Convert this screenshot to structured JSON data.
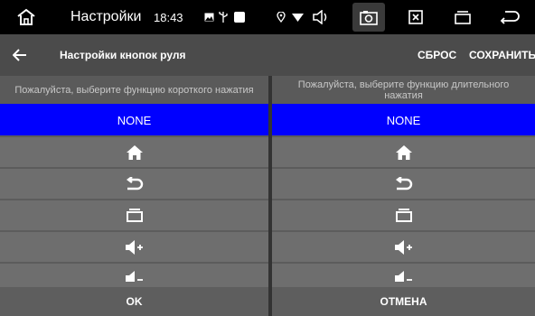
{
  "status_bar": {
    "title": "Настройки",
    "time": "18:43",
    "icons": [
      "home-outline-icon",
      "gallery-icon",
      "usb-icon",
      "square-icon",
      "location-icon",
      "wifi-icon",
      "volume-icon",
      "camera-icon",
      "close-box-icon",
      "recent-apps-icon",
      "back-arrow-icon"
    ]
  },
  "action_bar": {
    "title": "Настройки кнопок руля",
    "reset_label": "СБРОС",
    "save_label": "СОХРАНИТЬ"
  },
  "short_press": {
    "header": "Пожалуйста, выберите функцию короткого нажатия",
    "selected": "NONE",
    "options": [
      "NONE",
      "home-icon",
      "back-icon",
      "recent-apps-icon",
      "volume-up-icon",
      "volume-down-icon"
    ]
  },
  "long_press": {
    "header": "Пожалуйста, выберите функцию длительного нажатия",
    "selected": "NONE",
    "options": [
      "NONE",
      "home-icon",
      "back-icon",
      "recent-apps-icon",
      "volume-up-icon",
      "volume-down-icon"
    ]
  },
  "footer": {
    "ok_label": "OK",
    "cancel_label": "ОТМЕНА"
  },
  "colors": {
    "selected_row": "#0000ff",
    "row": "#6e6e6e",
    "action_bar": "#4b4b4b",
    "status_bar": "#000000"
  }
}
